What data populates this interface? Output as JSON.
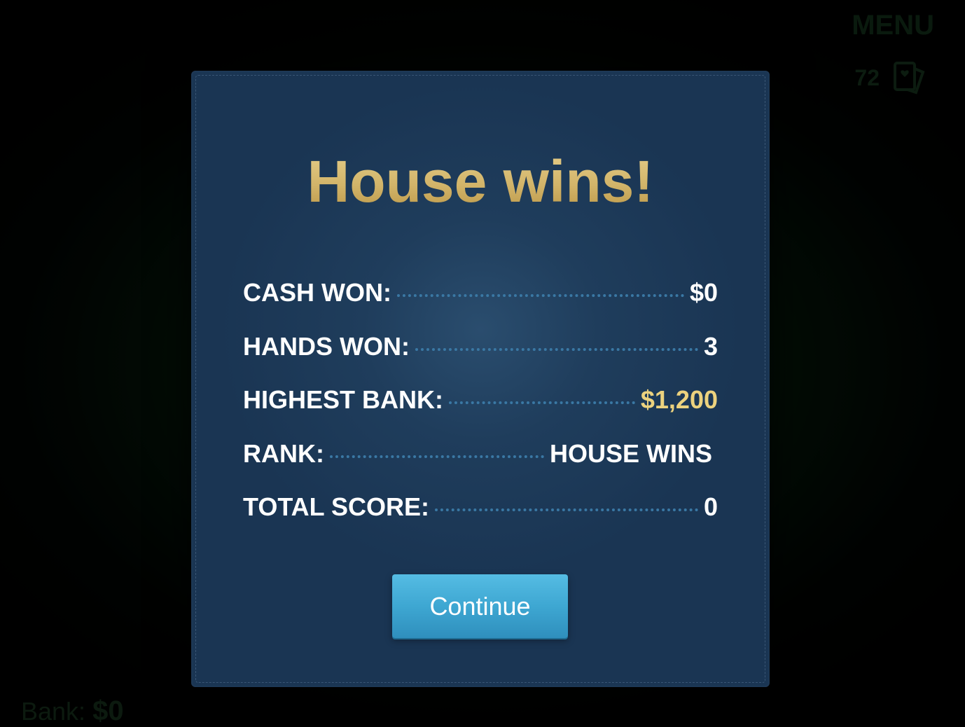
{
  "header": {
    "menu_label": "MENU",
    "deck_count": "72",
    "deck_icon": "card-deck-icon"
  },
  "footer": {
    "bank_label": "Bank:",
    "bank_value": "$0"
  },
  "modal": {
    "title": "House wins!",
    "stats": [
      {
        "label": "CASH WON:",
        "value": "$0"
      },
      {
        "label": "HANDS WON:",
        "value": "3"
      },
      {
        "label": "HIGHEST BANK:",
        "value": "$1,200"
      },
      {
        "label": "RANK:",
        "value": "HOUSE WINS"
      },
      {
        "label": "TOTAL SCORE:",
        "value": "0"
      }
    ],
    "continue_label": "Continue"
  },
  "colors": {
    "title_gold": "#d2b469",
    "highlight_value": "#ecd27e",
    "modal_bg": "#1f3d5c",
    "button_blue": "#3ea7d2",
    "table_green": "#0d3a18"
  }
}
